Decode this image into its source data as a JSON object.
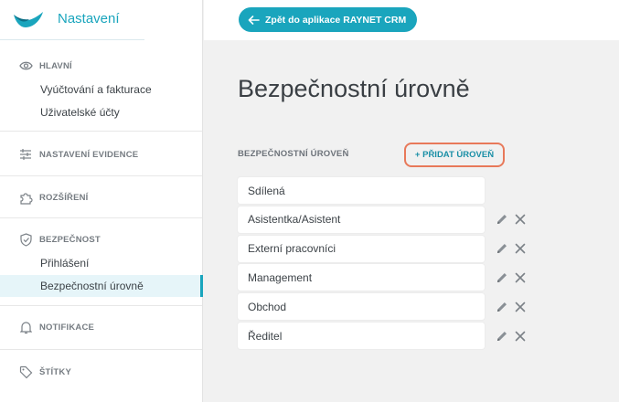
{
  "app": {
    "title": "Nastavení"
  },
  "sidebar": {
    "sections": [
      {
        "label": "HLAVNÍ",
        "icon": "eye-icon",
        "items": [
          {
            "label": "Vyúčtování a fakturace"
          },
          {
            "label": "Uživatelské účty"
          }
        ]
      },
      {
        "label": "NASTAVENÍ EVIDENCE",
        "icon": "sliders-icon",
        "items": []
      },
      {
        "label": "ROZŠÍŘENÍ",
        "icon": "puzzle-icon",
        "items": []
      },
      {
        "label": "BEZPEČNOST",
        "icon": "shield-icon",
        "items": [
          {
            "label": "Přihlášení"
          },
          {
            "label": "Bezpečnostní úrovně",
            "active": true
          }
        ]
      },
      {
        "label": "NOTIFIKACE",
        "icon": "bell-icon",
        "items": []
      },
      {
        "label": "ŠTÍTKY",
        "icon": "tag-icon",
        "items": []
      }
    ]
  },
  "topbar": {
    "back_label": "Zpět do aplikace RAYNET CRM"
  },
  "main": {
    "title": "Bezpečnostní úrovně",
    "list_label": "BEZPEČNOSTNÍ ÚROVEŇ",
    "add_label": "+ PŘIDAT ÚROVEŇ",
    "levels": [
      {
        "name": "Sdílená",
        "editable": false
      },
      {
        "name": "Asistentka/Asistent",
        "editable": true
      },
      {
        "name": "Externí pracovníci",
        "editable": true
      },
      {
        "name": "Management",
        "editable": true
      },
      {
        "name": "Obchod",
        "editable": true
      },
      {
        "name": "Ředitel",
        "editable": true
      }
    ]
  },
  "colors": {
    "accent": "#1aa5bd",
    "highlight": "#e8795a"
  }
}
